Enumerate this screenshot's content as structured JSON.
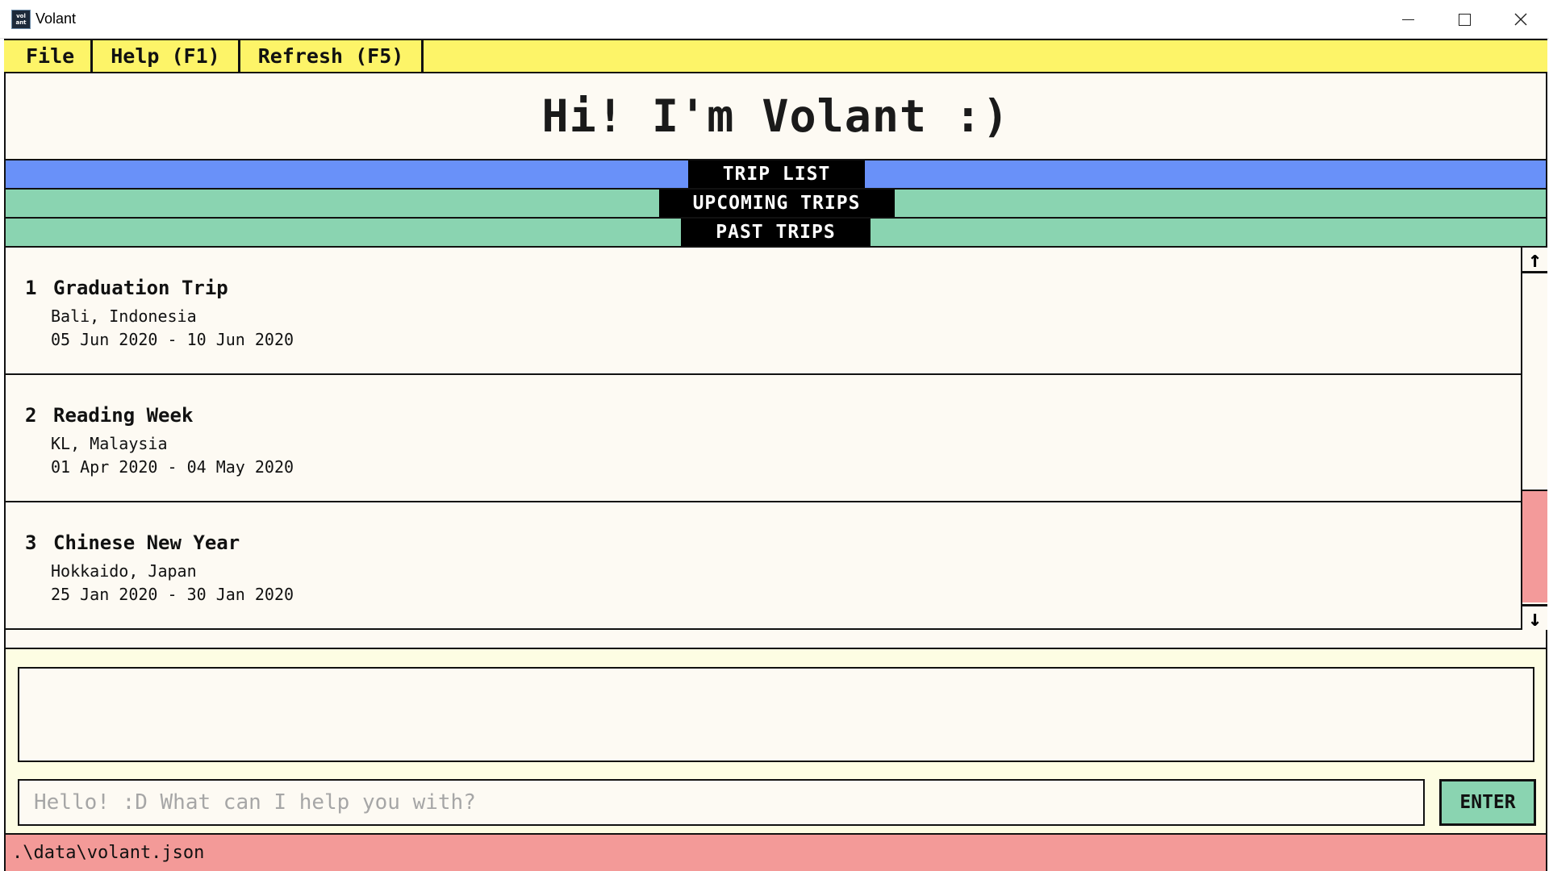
{
  "window": {
    "title": "Volant",
    "icon_text": "vol ant",
    "icon": "volant-app-icon"
  },
  "menu": {
    "items": [
      {
        "label": "File"
      },
      {
        "label": "Help (F1)"
      },
      {
        "label": "Refresh (F5)"
      }
    ]
  },
  "hero": {
    "greeting": "Hi! I'm Volant :)"
  },
  "tabs": {
    "trip_list": "TRIP LIST",
    "upcoming": "UPCOMING TRIPS",
    "past": "PAST TRIPS"
  },
  "trips": [
    {
      "index": "1",
      "name": "Graduation Trip",
      "location": "Bali, Indonesia",
      "dates": "05 Jun 2020 - 10 Jun 2020"
    },
    {
      "index": "2",
      "name": "Reading Week",
      "location": "KL, Malaysia",
      "dates": "01 Apr 2020 - 04 May 2020"
    },
    {
      "index": "3",
      "name": "Chinese New Year",
      "location": "Hokkaido, Japan",
      "dates": "25 Jan 2020 - 30 Jan 2020"
    }
  ],
  "command": {
    "placeholder": "Hello! :D What can I help you with?",
    "value": "",
    "result_text": "",
    "enter_label": "ENTER"
  },
  "status": {
    "file_path": ".\\data\\volant.json"
  },
  "colors": {
    "menubar": "#fdf468",
    "tab_active": "#6991f9",
    "tab_inactive": "#8ad4b1",
    "scroll_thumb": "#f39a9a",
    "statusbar": "#f39a98",
    "enter_button": "#8ad4b1"
  }
}
